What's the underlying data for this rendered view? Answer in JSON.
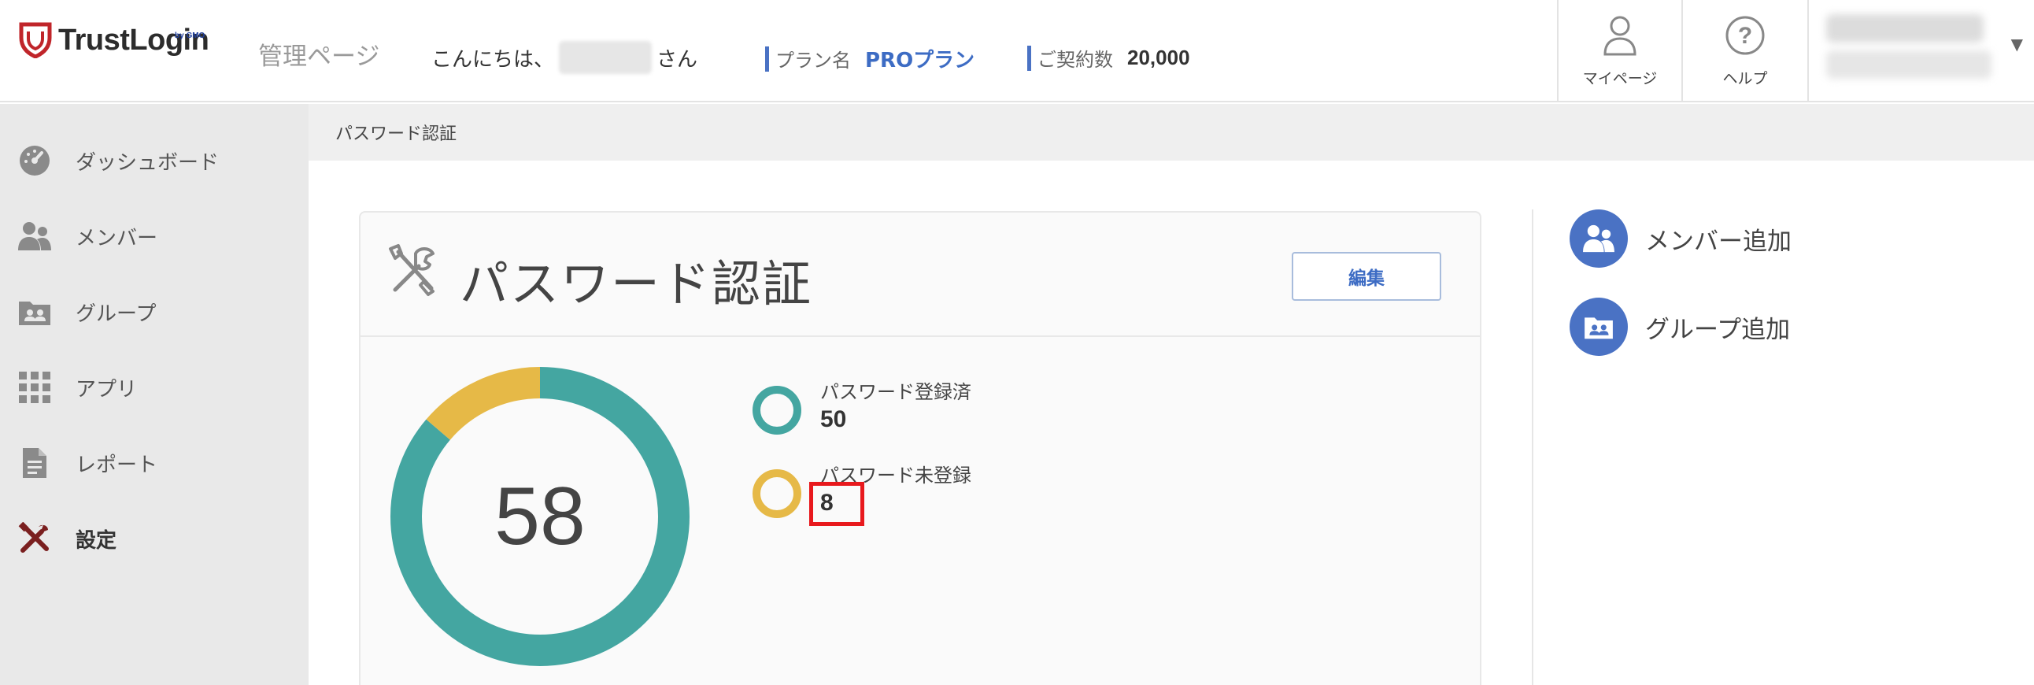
{
  "header": {
    "logo_text": "TrustLogin",
    "logo_sub": "by GMO",
    "admin_label": "管理ページ",
    "greeting_prefix": "こんにちは、",
    "greeting_suffix": "さん",
    "plan_label": "プラン名",
    "plan_value": "PROプラン",
    "contract_label": "ご契約数",
    "contract_value": "20,000",
    "mypage_label": "マイページ",
    "help_label": "ヘルプ"
  },
  "sidebar": {
    "items": [
      {
        "label": "ダッシュボード",
        "icon": "dashboard-icon"
      },
      {
        "label": "メンバー",
        "icon": "members-icon"
      },
      {
        "label": "グループ",
        "icon": "group-icon"
      },
      {
        "label": "アプリ",
        "icon": "apps-grid-icon"
      },
      {
        "label": "レポート",
        "icon": "report-icon"
      },
      {
        "label": "設定",
        "icon": "tools-icon",
        "active": true
      }
    ]
  },
  "breadcrumb": "パスワード認証",
  "card": {
    "title": "パスワード認証",
    "edit_label": "編集",
    "total": "58",
    "legend": [
      {
        "label": "パスワード登録済",
        "value": "50",
        "color": "#44a6a1"
      },
      {
        "label": "パスワード未登録",
        "value": "8",
        "color": "#e6b947"
      }
    ]
  },
  "quick_actions": [
    {
      "label": "メンバー追加",
      "icon": "add-member-icon"
    },
    {
      "label": "グループ追加",
      "icon": "add-group-icon"
    }
  ],
  "chart_data": {
    "type": "pie",
    "donut": true,
    "categories": [
      "パスワード登録済",
      "パスワード未登録"
    ],
    "values": [
      50,
      8
    ],
    "colors": [
      "#44a6a1",
      "#e6b947"
    ],
    "center_label": "58"
  },
  "colors": {
    "accent": "#3d6cc4",
    "sidebar_bg": "#e9e9e9",
    "active_icon": "#7a1f1f",
    "highlight": "#e8191d"
  }
}
